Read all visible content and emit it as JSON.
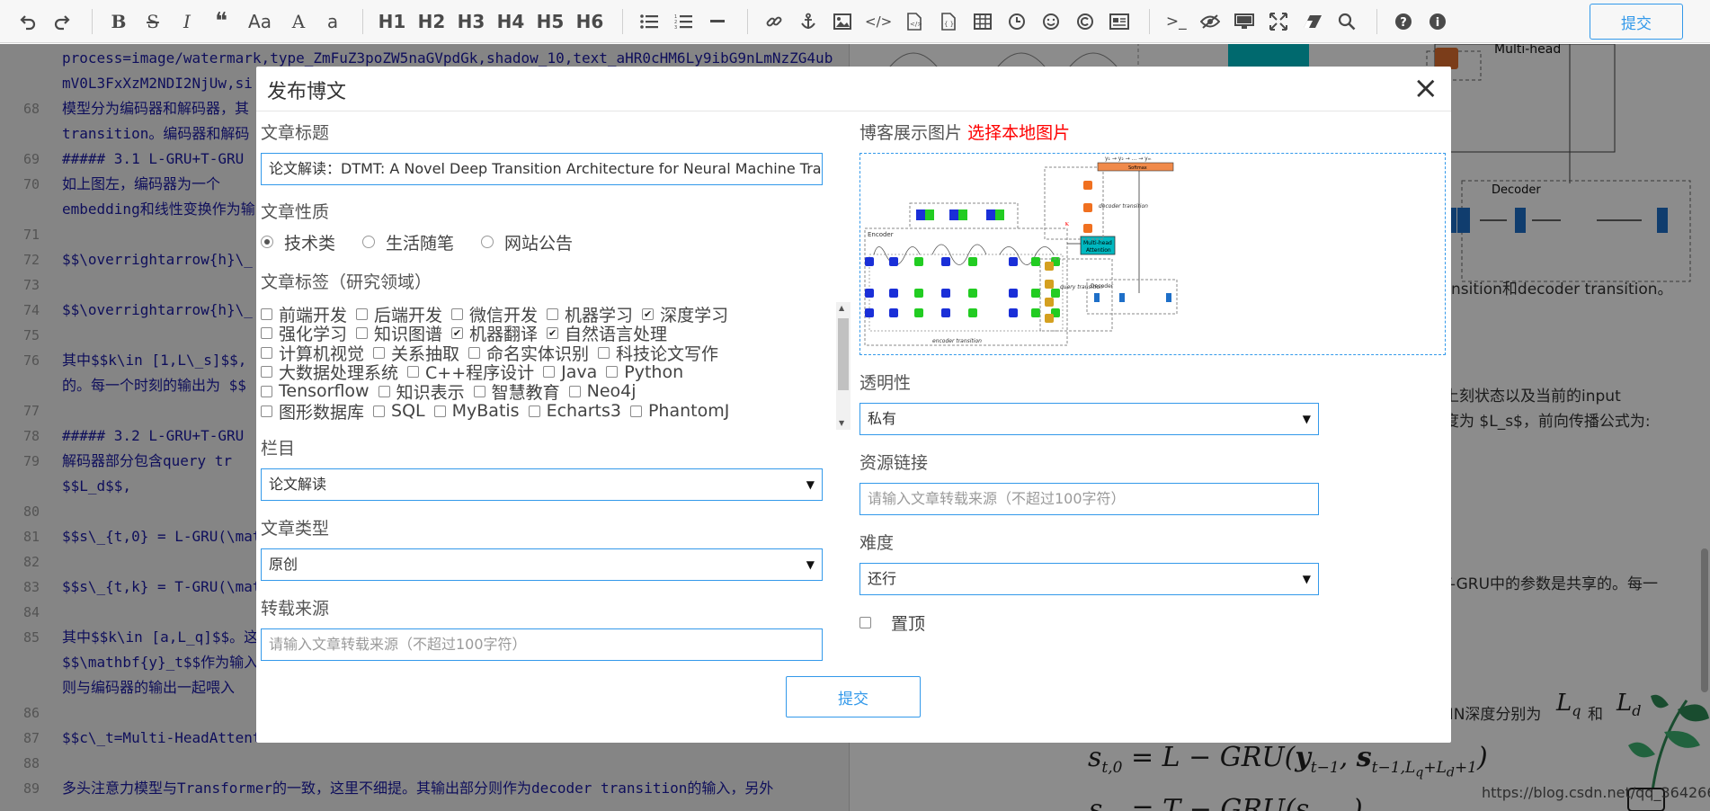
{
  "toolbar": {
    "icons": [
      "undo-icon",
      "redo-icon",
      "bold-icon",
      "strikethrough-icon",
      "italic-icon",
      "quote-icon",
      "uppercase-icon",
      "capitalize-icon",
      "lowercase-icon",
      "h1",
      "h2",
      "h3",
      "h4",
      "h5",
      "h6",
      "unordered-list-icon",
      "ordered-list-icon",
      "horizontal-rule-icon",
      "link-icon",
      "anchor-icon",
      "image-icon",
      "code-inline-icon",
      "code-block-icon",
      "preformatted-icon",
      "table-icon",
      "datetime-icon",
      "emoji-icon",
      "html-entities-icon",
      "pagebreak-icon",
      "terminal-icon",
      "watch-icon",
      "preview-icon",
      "fullscreen-icon",
      "clear-icon",
      "search-icon",
      "help-icon",
      "info-icon"
    ],
    "glyphs": {
      "bold": "B",
      "strike": "S",
      "italic": "I",
      "quote": "❝",
      "upper": "Aa",
      "cap": "A",
      "lower": "a",
      "h1": "H1",
      "h2": "H2",
      "h3": "H3",
      "h4": "H4",
      "h5": "H5",
      "h6": "H6"
    },
    "submit_label": "提交"
  },
  "editor": {
    "lines": [
      {
        "num": "",
        "text": "process=image/watermark,type_ZmFuZ3poZW5naGVpdGk,shadow_10,text_aHR0cHM6Ly9ibG9nLmNzZG4ub"
      },
      {
        "num": "",
        "text": "mV0L3FxXzM2NDI2NjUw,si"
      },
      {
        "num": "68",
        "text": "模型分为编码器和解码器，其"
      },
      {
        "num": "",
        "text": "transition。编码器和解码"
      },
      {
        "num": "69",
        "text": "#####  3.1 L-GRU+T-GRU"
      },
      {
        "num": "70",
        "text": "  如上图左，编码器为一个"
      },
      {
        "num": "",
        "text": "embedding和线性变换作为输"
      },
      {
        "num": "71",
        "text": ""
      },
      {
        "num": "72",
        "text": "$$\\overrightarrow{h}\\_"
      },
      {
        "num": "73",
        "text": ""
      },
      {
        "num": "74",
        "text": "$$\\overrightarrow{h}\\_"
      },
      {
        "num": "75",
        "text": ""
      },
      {
        "num": "76",
        "text": "其中$$k\\in [1,L\\_s]$$,"
      },
      {
        "num": "",
        "text": "的。每一个时刻的输出为 $$"
      },
      {
        "num": "77",
        "text": ""
      },
      {
        "num": "78",
        "text": "#####  3.2 L-GRU+T-GRU"
      },
      {
        "num": "79",
        "text": "  解码器部分包含query tr"
      },
      {
        "num": "",
        "text": "$$L_d$$,"
      },
      {
        "num": "80",
        "text": ""
      },
      {
        "num": "81",
        "text": "$$s\\_{t,0} = L-GRU(\\mat"
      },
      {
        "num": "82",
        "text": ""
      },
      {
        "num": "83",
        "text": "$$s\\_{t,k} = T-GRU(\\mat"
      },
      {
        "num": "84",
        "text": ""
      },
      {
        "num": "85",
        "text": "其中$$k\\in [a,L_q]$$。这"
      },
      {
        "num": "",
        "text": "$$\\mathbf{y}_t$$作为输入"
      },
      {
        "num": "",
        "text": "则与编码器的输出一起喂入"
      },
      {
        "num": "86",
        "text": ""
      },
      {
        "num": "87",
        "text": "$$c\\_t=Multi-HeadAttent"
      },
      {
        "num": "88",
        "text": ""
      },
      {
        "num": "89",
        "text": "多头注意力模型与Transformer的一致，这里不细提。其输出部分则作为decoder transition的输入，另外"
      }
    ]
  },
  "preview": {
    "decoder_label": "Decoder",
    "multihead_label": "Multi-head",
    "attention_label": "Attention",
    "text1": "nsition和decoder transition。",
    "text2": "上刻状态以及当前的input",
    "text3": "度为 $L_s$，前向传播公式为:",
    "text4": "T-GRU中的参数是共享的。每一",
    "text5": "NN深度分别为",
    "text5_and": "和",
    "math1": "s",
    "math_eq": "= L − GRU(y",
    "math_tail": ", s",
    "watermark": "https://blog.csdn.net/qq_36426650"
  },
  "modal": {
    "title": "发布博文",
    "close": "×",
    "article_title_label": "文章标题",
    "article_title_value": "论文解读：DTMT: A Novel Deep Transition Architecture for Neural Machine Translation",
    "nature_label": "文章性质",
    "nature_options": [
      {
        "label": "技术类",
        "checked": true
      },
      {
        "label": "生活随笔",
        "checked": false
      },
      {
        "label": "网站公告",
        "checked": false
      }
    ],
    "tags_label": "文章标签（研究领域）",
    "tag_rows": [
      [
        {
          "label": "前端开发",
          "c": false
        },
        {
          "label": "后端开发",
          "c": false
        },
        {
          "label": "微信开发",
          "c": false
        },
        {
          "label": "机器学习",
          "c": false
        },
        {
          "label": "深度学习",
          "c": true
        }
      ],
      [
        {
          "label": "强化学习",
          "c": false
        },
        {
          "label": "知识图谱",
          "c": false
        },
        {
          "label": "机器翻译",
          "c": true
        },
        {
          "label": "自然语言处理",
          "c": true
        }
      ],
      [
        {
          "label": "计算机视觉",
          "c": false
        },
        {
          "label": "关系抽取",
          "c": false
        },
        {
          "label": "命名实体识别",
          "c": false
        },
        {
          "label": "科技论文写作",
          "c": false
        }
      ],
      [
        {
          "label": "大数据处理系统",
          "c": false
        },
        {
          "label": "C++程序设计",
          "c": false
        },
        {
          "label": "Java",
          "c": false
        },
        {
          "label": "Python",
          "c": false
        }
      ],
      [
        {
          "label": "Tensorflow",
          "c": false
        },
        {
          "label": "知识表示",
          "c": false
        },
        {
          "label": "智慧教育",
          "c": false
        },
        {
          "label": "Neo4j",
          "c": false
        }
      ],
      [
        {
          "label": "图形数据库",
          "c": false
        },
        {
          "label": "SQL",
          "c": false
        },
        {
          "label": "MyBatis",
          "c": false
        },
        {
          "label": "Echarts3",
          "c": false
        },
        {
          "label": "PhantomJS",
          "c": false
        }
      ]
    ],
    "column_label": "栏目",
    "column_value": "论文解读",
    "type_label": "文章类型",
    "type_value": "原创",
    "repost_label": "转载来源",
    "repost_placeholder": "请输入文章转载来源（不超过100字符）",
    "cover_label": "博客展示图片",
    "cover_link": "选择本地图片",
    "visibility_label": "透明性",
    "visibility_value": "私有",
    "resource_label": "资源链接",
    "resource_placeholder": "请输入文章转载来源（不超过100字符）",
    "difficulty_label": "难度",
    "difficulty_value": "还行",
    "pin_label": "置顶",
    "submit_label": "提交"
  },
  "colors": {
    "accent": "#3399ea",
    "red_link": "#ff0000",
    "code_blue": "#1a1aa6",
    "overlay": "rgba(0,0,0,0.45)"
  }
}
